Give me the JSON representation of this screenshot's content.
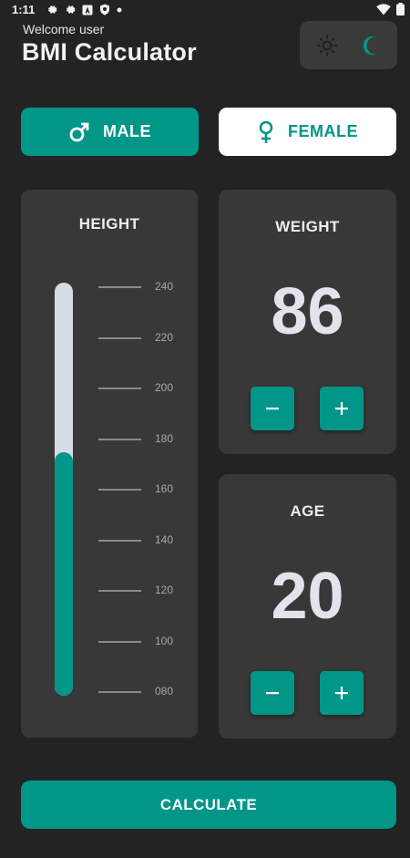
{
  "status_bar": {
    "time": "1:11",
    "icons": [
      "gear-icon",
      "gear-icon",
      "a-icon",
      "shield-icon",
      "dot-icon"
    ],
    "right_icons": [
      "wifi-icon",
      "battery-icon"
    ]
  },
  "header": {
    "welcome": "Welcome user",
    "title": "BMI Calculator"
  },
  "theme_toggle": {
    "options": [
      "sun-icon",
      "moon-icon"
    ],
    "selected": "dark"
  },
  "gender": {
    "male_label": "MALE",
    "female_label": "FEMALE",
    "selected": "male"
  },
  "height": {
    "title": "HEIGHT",
    "ticks": [
      "240",
      "220",
      "200",
      "180",
      "160",
      "140",
      "120",
      "100",
      "080"
    ],
    "min": 80,
    "max": 240,
    "value": 160
  },
  "weight": {
    "title": "WEIGHT",
    "value": "86"
  },
  "age": {
    "title": "AGE",
    "value": "20"
  },
  "calculate_label": "CALCULATE",
  "colors": {
    "accent": "#009688",
    "background": "#232323",
    "card": "#383838"
  }
}
